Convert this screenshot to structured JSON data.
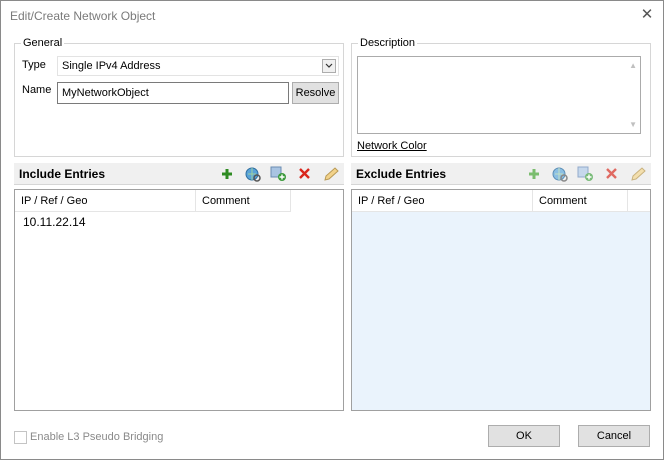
{
  "window": {
    "title": "Edit/Create Network Object",
    "close": "✕"
  },
  "general": {
    "legend": "General",
    "type_label": "Type",
    "type_value": "Single IPv4 Address",
    "name_label": "Name",
    "name_value": "MyNetworkObject",
    "resolve_label": "Resolve"
  },
  "description": {
    "legend": "Description",
    "network_color_link": "Network Color"
  },
  "include": {
    "title": "Include Entries",
    "columns": [
      "IP / Ref / Geo",
      "Comment"
    ],
    "rows": [
      [
        "10.11.22.14",
        ""
      ]
    ]
  },
  "exclude": {
    "title": "Exclude Entries",
    "columns": [
      "IP / Ref / Geo",
      "Comment"
    ],
    "rows": []
  },
  "footer": {
    "checkbox_label": "Enable L3 Pseudo Bridging",
    "ok_label": "OK",
    "cancel_label": "Cancel"
  },
  "colors": {
    "exclude_list_bg": "#eaf3fc",
    "add_icon": "#2e8b22",
    "delete_icon": "#d9261c"
  },
  "icons": [
    "add-icon",
    "globe-search-icon",
    "add-reference-icon",
    "delete-icon",
    "edit-pencil-icon"
  ]
}
